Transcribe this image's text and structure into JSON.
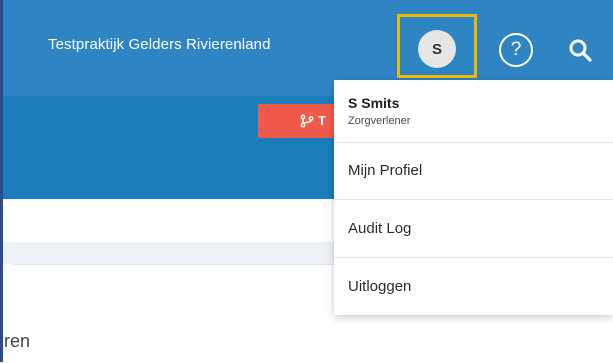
{
  "header": {
    "practice_name": "Testpraktijk Gelders Rivierenland",
    "avatar_initial": "S",
    "help_glyph": "?",
    "icons": {
      "help": "question-circle-icon",
      "search": "search-icon"
    }
  },
  "toolbar": {
    "button_label": "T",
    "button_icon": "git-branch-icon"
  },
  "user_menu": {
    "name": "S Smits",
    "role": "Zorgverlener",
    "items": [
      {
        "label": "Mijn Profiel"
      },
      {
        "label": "Audit Log"
      },
      {
        "label": "Uitloggen"
      }
    ]
  },
  "content": {
    "partial_text": "ren"
  },
  "colors": {
    "header_bg": "#2f85c3",
    "subbar_bg": "#1a7dba",
    "accent_red": "#f05a4a",
    "highlight": "#f2b705"
  }
}
